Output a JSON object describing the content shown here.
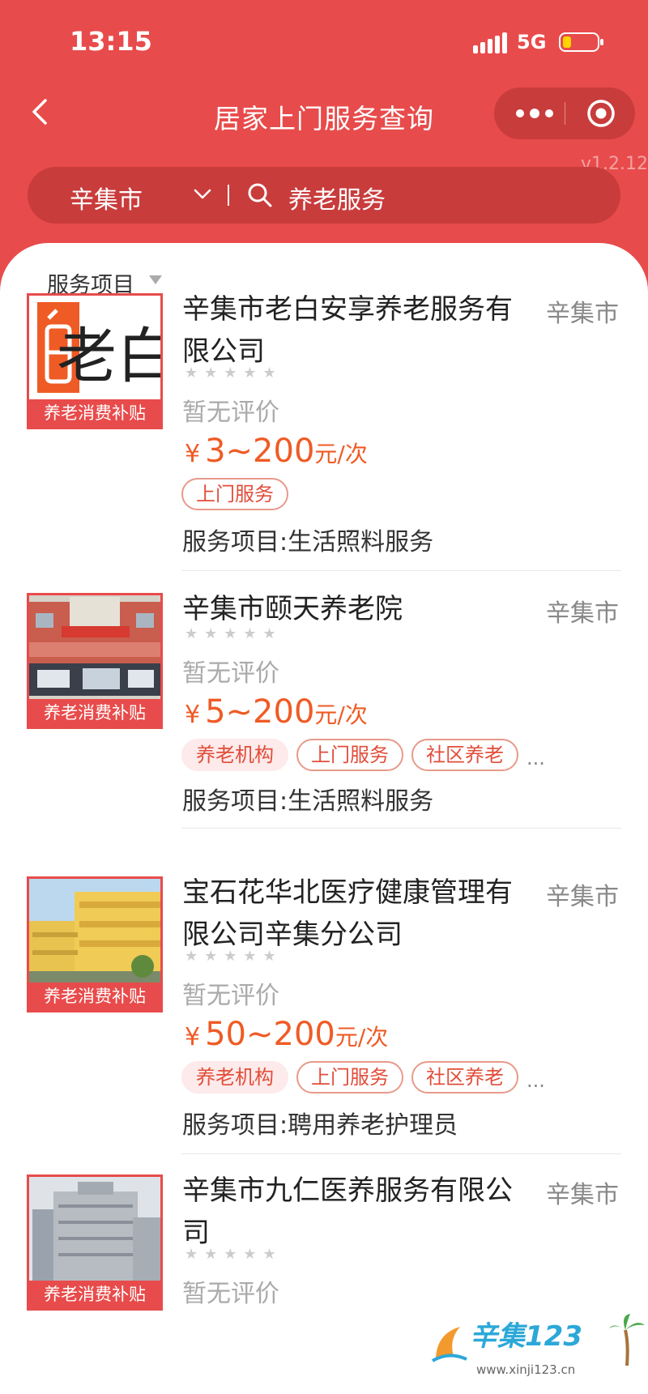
{
  "status": {
    "time": "13:15",
    "network": "5G"
  },
  "header": {
    "title": "居家上门服务查询",
    "version": "v1.2.12"
  },
  "search": {
    "city": "辛集市",
    "keyword": "养老服务"
  },
  "filter": {
    "label": "服务项目"
  },
  "items": [
    {
      "name": "辛集市老白安享养老服务有限公司",
      "location": "辛集市",
      "badge": "养老消费补贴",
      "stars": "★★★★★",
      "review": "暂无评价",
      "price_symbol": "¥",
      "price_range": "3~200",
      "price_unit": "元/次",
      "tags": [
        "上门服务"
      ],
      "service": "服务项目:生活照料服务",
      "logo_text": "老白"
    },
    {
      "name": "辛集市颐天养老院",
      "location": "辛集市",
      "badge": "养老消费补贴",
      "stars": "★★★★★",
      "review": "暂无评价",
      "price_symbol": "¥",
      "price_range": "5~200",
      "price_unit": "元/次",
      "tags": [
        "养老机构",
        "上门服务",
        "社区养老"
      ],
      "more": "...",
      "service": "服务项目:生活照料服务"
    },
    {
      "name": "宝石花华北医疗健康管理有限公司辛集分公司",
      "location": "辛集市",
      "badge": "养老消费补贴",
      "stars": "★★★★★",
      "review": "暂无评价",
      "price_symbol": "¥",
      "price_range": "50~200",
      "price_unit": "元/次",
      "tags": [
        "养老机构",
        "上门服务",
        "社区养老"
      ],
      "more": "...",
      "service": "服务项目:聘用养老护理员"
    },
    {
      "name": "辛集市九仁医养服务有限公司",
      "location": "辛集市",
      "badge": "养老消费补贴",
      "stars": "★★★★★",
      "review": "暂无评价"
    }
  ],
  "watermark": {
    "brand": "辛集123",
    "url": "www.xinji123.cn"
  },
  "colors": {
    "primary": "#e84b4b",
    "price": "#ef5b25"
  }
}
